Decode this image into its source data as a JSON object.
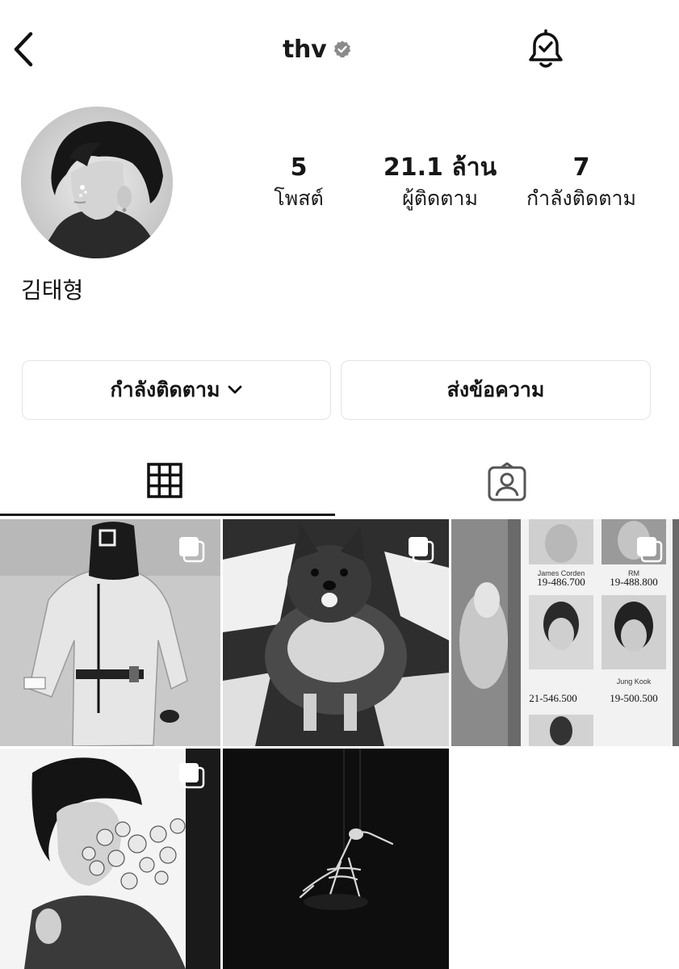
{
  "header": {
    "username": "thv",
    "verified": true
  },
  "profile": {
    "display_name": "김태형",
    "stats": {
      "posts": {
        "value": "5",
        "label": "โพสต์"
      },
      "followers": {
        "value": "21.1 ล้าน",
        "label": "ผู้ติดตาม"
      },
      "following": {
        "value": "7",
        "label": "กำลังติดตาม"
      }
    }
  },
  "actions": {
    "following_label": "กำลังติดตาม",
    "message_label": "ส่งข้อความ"
  },
  "tabs": [
    {
      "name": "posts-grid",
      "icon": "grid-icon",
      "active": true
    },
    {
      "name": "tagged",
      "icon": "tagged-person-icon",
      "active": false
    }
  ],
  "grid": [
    {
      "subject": "person in hooded jumpsuit",
      "multi": true
    },
    {
      "subject": "pomeranian dog",
      "multi": true
    },
    {
      "subject": "photo booth strip",
      "multi": true,
      "captions": [
        "James Corden",
        "RM",
        "Jung Kook"
      ],
      "handwriting": [
        "19-486.700",
        "19-488.800",
        "21-546.500",
        "19-500.500"
      ]
    },
    {
      "subject": "portrait with flowers",
      "multi": true
    },
    {
      "subject": "skeleton bird sculpture",
      "multi": false
    }
  ],
  "colors": {
    "text": "#111111",
    "border": "#e3e3e3",
    "verified_badge": "#8a8a8a"
  }
}
